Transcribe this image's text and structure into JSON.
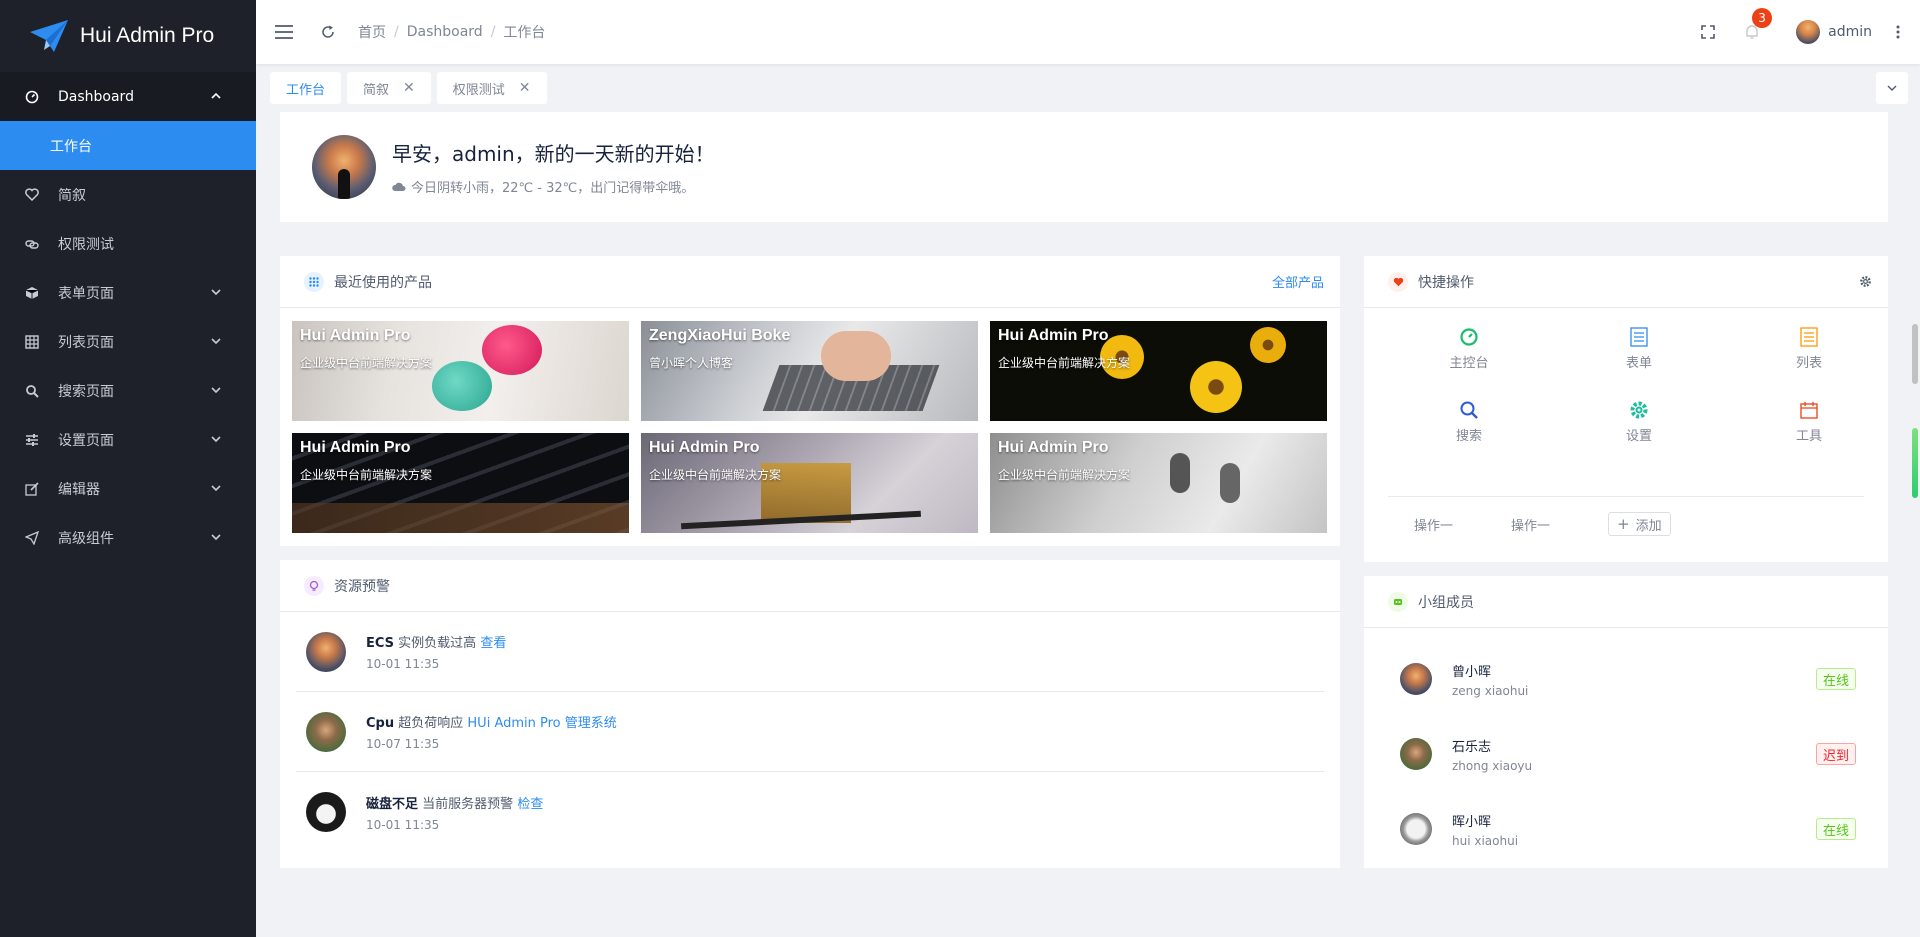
{
  "app": {
    "title": "Hui Admin Pro"
  },
  "sidebar": {
    "items": [
      {
        "label": "Dashboard",
        "icon": "dashboard-icon"
      },
      {
        "label": "工作台"
      },
      {
        "label": "简叙",
        "icon": "heart-icon"
      },
      {
        "label": "权限测试",
        "icon": "link-icon"
      },
      {
        "label": "表单页面",
        "icon": "cube-icon"
      },
      {
        "label": "列表页面",
        "icon": "grid-icon"
      },
      {
        "label": "搜索页面",
        "icon": "search-icon"
      },
      {
        "label": "设置页面",
        "icon": "sliders-icon"
      },
      {
        "label": "编辑器",
        "icon": "edit-icon"
      },
      {
        "label": "高级组件",
        "icon": "send-icon"
      }
    ]
  },
  "header": {
    "breadcrumb": [
      "首页",
      "Dashboard",
      "工作台"
    ],
    "notification_count": "3",
    "user_name": "admin"
  },
  "tabs": [
    {
      "label": "工作台"
    },
    {
      "label": "简叙"
    },
    {
      "label": "权限测试"
    }
  ],
  "welcome": {
    "title": "早安，admin，新的一天新的开始！",
    "weather": "今日阴转小雨，22℃ - 32℃，出门记得带伞哦。"
  },
  "products": {
    "title": "最近使用的产品",
    "all_link": "全部产品",
    "items": [
      {
        "title": "Hui Admin Pro",
        "desc": "企业级中台前端解决方案"
      },
      {
        "title": "ZengXiaoHui Boke",
        "desc": "曾小晖个人博客"
      },
      {
        "title": "Hui Admin Pro",
        "desc": "企业级中台前端解决方案"
      },
      {
        "title": "Hui Admin Pro",
        "desc": "企业级中台前端解决方案"
      },
      {
        "title": "Hui Admin Pro",
        "desc": "企业级中台前端解决方案"
      },
      {
        "title": "Hui Admin Pro",
        "desc": "企业级中台前端解决方案"
      }
    ]
  },
  "alerts": {
    "title": "资源预警",
    "items": [
      {
        "subject": "ECS",
        "text": "实例负载过高",
        "link": "查看",
        "time": "10-01 11:35"
      },
      {
        "subject": "Cpu",
        "text": "超负荷响应",
        "link": "HUi Admin Pro 管理系统",
        "time": "10-07 11:35"
      },
      {
        "subject": "磁盘不足",
        "text": "当前服务器预警",
        "link": "检查",
        "time": "10-01 11:35"
      }
    ]
  },
  "quick": {
    "title": "快捷操作",
    "items": [
      {
        "label": "主控台",
        "icon": "dashboard-icon",
        "color": "#19be6b"
      },
      {
        "label": "表单",
        "icon": "form-icon",
        "color": "#2d8cf0"
      },
      {
        "label": "列表",
        "icon": "list-icon",
        "color": "#ff9900"
      },
      {
        "label": "搜索",
        "icon": "search-icon",
        "color": "#2d8cf0"
      },
      {
        "label": "设置",
        "icon": "gear-icon",
        "color": "#19be9b"
      },
      {
        "label": "工具",
        "icon": "calendar-icon",
        "color": "#ed4014"
      }
    ],
    "actions": [
      "操作一",
      "操作一"
    ],
    "add_label": "添加"
  },
  "members": {
    "title": "小组成员",
    "items": [
      {
        "name": "曾小晖",
        "account": "zeng xiaohui",
        "status": "在线"
      },
      {
        "name": "石乐志",
        "account": "zhong xiaoyu",
        "status": "迟到"
      },
      {
        "name": "晖小晖",
        "account": "hui xiaohui",
        "status": "在线"
      }
    ]
  },
  "colors": {
    "sidebar_bg": "#1e2129",
    "primary": "#2d8cf0",
    "badge": "#ed4014",
    "online": "#52c41a",
    "late": "#f5222d"
  }
}
